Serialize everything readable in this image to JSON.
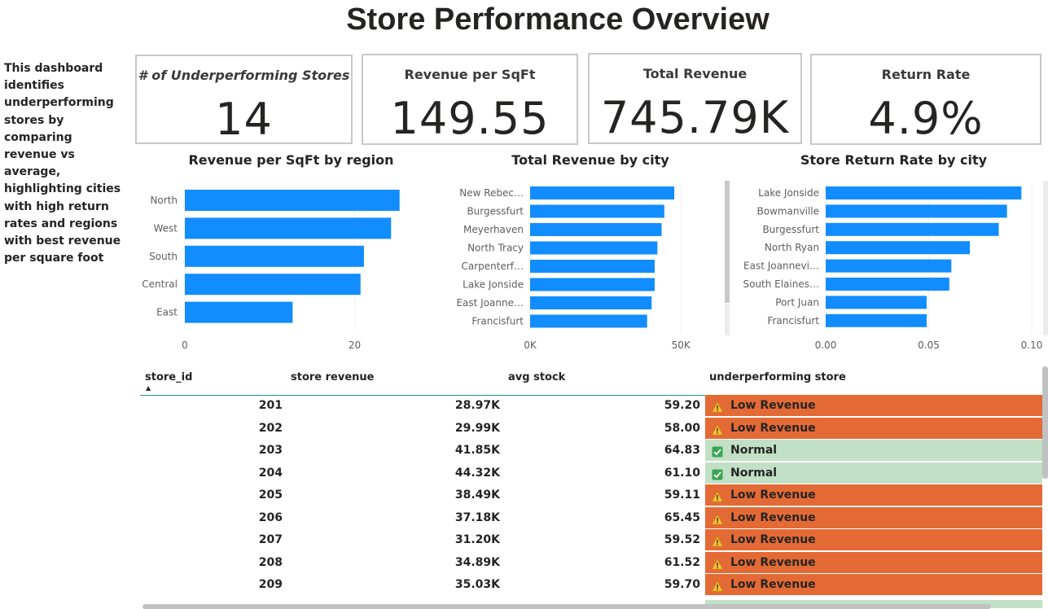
{
  "title": "Store Performance Overview",
  "description": [
    "This dashboard",
    "identifies",
    "underperforming",
    "stores by comparing",
    "revenue vs average,",
    "highlighting cities",
    "with high return",
    "rates and regions",
    "with best revenue",
    "per square foot"
  ],
  "cards": [
    {
      "label": "# of Underperforming Stores",
      "value": "14"
    },
    {
      "label": "Revenue per SqFt",
      "value": "149.55"
    },
    {
      "label": "Total Revenue",
      "value": "745.79K"
    },
    {
      "label": "Return Rate",
      "value": "4.9%"
    }
  ],
  "colors": {
    "bar": "#118dff",
    "low": "#e46a35",
    "normal": "#c2e0c6",
    "header_line": "#1f8a9f"
  },
  "chart_data": [
    {
      "type": "bar",
      "orientation": "horizontal",
      "title": "Revenue per SqFt by region",
      "categories": [
        "North",
        "West",
        "South",
        "Central",
        "East"
      ],
      "values": [
        25.3,
        24.3,
        21.1,
        20.7,
        12.7
      ],
      "xlim": [
        0,
        26
      ],
      "ticks": [
        {
          "value": 0,
          "label": "0"
        },
        {
          "value": 20,
          "label": "20"
        }
      ]
    },
    {
      "type": "bar",
      "orientation": "horizontal",
      "title": "Total Revenue by city",
      "categories": [
        "New Rebec…",
        "Burgessfurt",
        "Meyerhaven",
        "North Tracy",
        "Carpenterf…",
        "Lake Jonside",
        "East Joanne…",
        "Francisfurt"
      ],
      "values": [
        47800,
        44500,
        43600,
        42200,
        41300,
        41300,
        40300,
        38800
      ],
      "xlim": [
        0,
        54000
      ],
      "ticks": [
        {
          "value": 0,
          "label": "0K"
        },
        {
          "value": 50000,
          "label": "50K"
        }
      ]
    },
    {
      "type": "bar",
      "orientation": "horizontal",
      "title": "Store Return Rate by city",
      "categories": [
        "Lake Jonside",
        "Bowmanville",
        "Burgessfurt",
        "North Ryan",
        "East Joannevi…",
        "South Elaines…",
        "Port Juan",
        "Francisfurt"
      ],
      "values": [
        0.095,
        0.088,
        0.084,
        0.07,
        0.061,
        0.06,
        0.049,
        0.049
      ],
      "xlim": [
        0,
        0.1
      ],
      "ticks": [
        {
          "value": 0,
          "label": "0.00"
        },
        {
          "value": 0.05,
          "label": "0.05"
        },
        {
          "value": 0.1,
          "label": "0.10"
        }
      ]
    }
  ],
  "table": {
    "columns": [
      "store_id",
      "store revenue",
      "avg stock",
      "underperforming store"
    ],
    "rows": [
      {
        "store_id": "201",
        "revenue": "28.97K",
        "avg_stock": "59.20",
        "status": "Low Revenue",
        "type": "low"
      },
      {
        "store_id": "202",
        "revenue": "29.99K",
        "avg_stock": "58.00",
        "status": "Low Revenue",
        "type": "low"
      },
      {
        "store_id": "203",
        "revenue": "41.85K",
        "avg_stock": "64.83",
        "status": "Normal",
        "type": "normal"
      },
      {
        "store_id": "204",
        "revenue": "44.32K",
        "avg_stock": "61.10",
        "status": "Normal",
        "type": "normal"
      },
      {
        "store_id": "205",
        "revenue": "38.49K",
        "avg_stock": "59.11",
        "status": "Low Revenue",
        "type": "low"
      },
      {
        "store_id": "206",
        "revenue": "37.18K",
        "avg_stock": "65.45",
        "status": "Low Revenue",
        "type": "low"
      },
      {
        "store_id": "207",
        "revenue": "31.20K",
        "avg_stock": "59.52",
        "status": "Low Revenue",
        "type": "low"
      },
      {
        "store_id": "208",
        "revenue": "34.89K",
        "avg_stock": "61.52",
        "status": "Low Revenue",
        "type": "low"
      },
      {
        "store_id": "209",
        "revenue": "35.03K",
        "avg_stock": "59.70",
        "status": "Low Revenue",
        "type": "low"
      }
    ]
  }
}
